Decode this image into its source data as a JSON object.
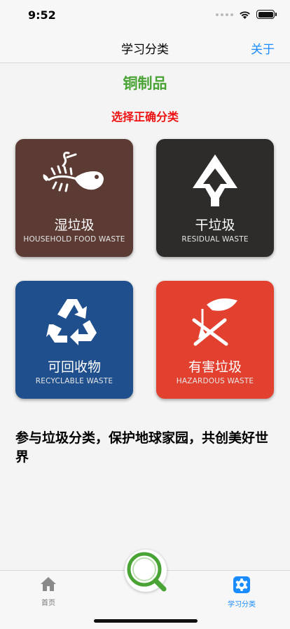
{
  "status_bar": {
    "time": "9:52"
  },
  "nav": {
    "title": "学习分类",
    "about_label": "关于"
  },
  "item": {
    "name": "铜制品"
  },
  "prompt": "选择正确分类",
  "categories": [
    {
      "cn": "湿垃圾",
      "en": "HOUSEHOLD FOOD WASTE",
      "color": "#5b3b33",
      "icon": "fish-bone-icon"
    },
    {
      "cn": "干垃圾",
      "en": "RESIDUAL WASTE",
      "color": "#2d2c2a",
      "icon": "residual-triangle-icon"
    },
    {
      "cn": "可回收物",
      "en": "RECYCLABLE WASTE",
      "color": "#1f4f8c",
      "icon": "recycle-icon"
    },
    {
      "cn": "有害垃圾",
      "en": "HAZARDOUS WASTE",
      "color": "#e2412f",
      "icon": "hazard-icon"
    }
  ],
  "slogan": "参与垃圾分类，保护地球家园，共创美好世界",
  "tabs": [
    {
      "label": "首页",
      "icon": "home-icon",
      "active": false
    },
    {
      "label": "学习分类",
      "icon": "gear-icon",
      "active": true
    }
  ],
  "scan_button": {
    "icon": "magnifier-icon"
  },
  "colors": {
    "accent": "#1a8cff",
    "item_name": "#4aa435",
    "prompt": "#ee1111"
  }
}
